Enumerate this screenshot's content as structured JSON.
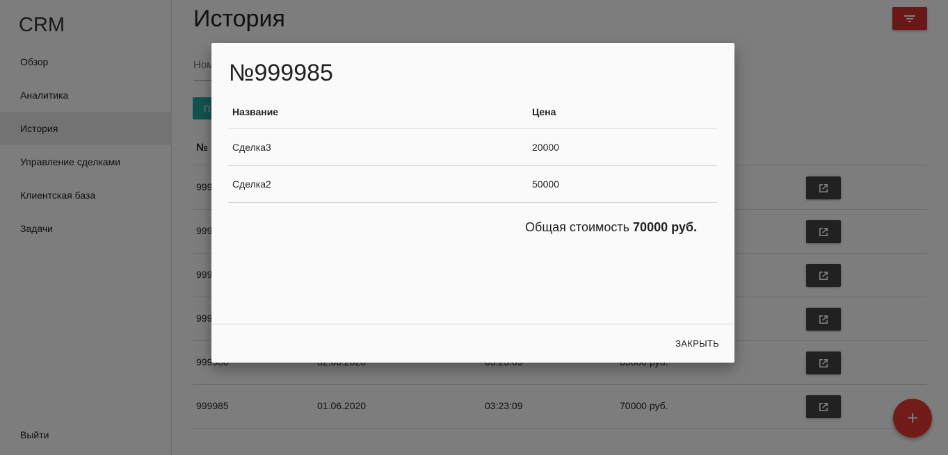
{
  "sidebar": {
    "logo": "CRM",
    "items": [
      {
        "label": "Обзор"
      },
      {
        "label": "Аналитика"
      },
      {
        "label": "История"
      },
      {
        "label": "Управление сделками"
      },
      {
        "label": "Клиентская база"
      },
      {
        "label": "Задачи"
      }
    ],
    "logout": "Выйти"
  },
  "main": {
    "title": "История",
    "search_placeholder": "Номер",
    "apply_label": "П",
    "table": {
      "header_no": "№",
      "rows": [
        {
          "id": "999",
          "date": "",
          "time": "",
          "total": ""
        },
        {
          "id": "999",
          "date": "",
          "time": "",
          "total": ""
        },
        {
          "id": "999",
          "date": "",
          "time": "",
          "total": ""
        },
        {
          "id": "999",
          "date": "",
          "time": "",
          "total": ""
        },
        {
          "id": "999986",
          "date": "02.06.2020",
          "time": "03:23:09",
          "total": "65000 руб."
        },
        {
          "id": "999985",
          "date": "01.06.2020",
          "time": "03:23:09",
          "total": "70000 руб."
        }
      ]
    },
    "fab_label": "+"
  },
  "modal": {
    "title": "№999985",
    "col_name": "Название",
    "col_price": "Цена",
    "items": [
      {
        "name": "Сделка3",
        "price": "20000"
      },
      {
        "name": "Сделка2",
        "price": "50000"
      }
    ],
    "total_label": "Общая стоимость",
    "total_value": "70000 руб.",
    "close_label": "ЗАКРЫТЬ"
  },
  "colors": {
    "accent_red": "#d32f2f",
    "teal": "#26a69a",
    "dark_button": "#424242"
  },
  "icons": {
    "filter": "filter-list-icon",
    "open": "open-in-new-icon",
    "add": "plus-icon"
  }
}
